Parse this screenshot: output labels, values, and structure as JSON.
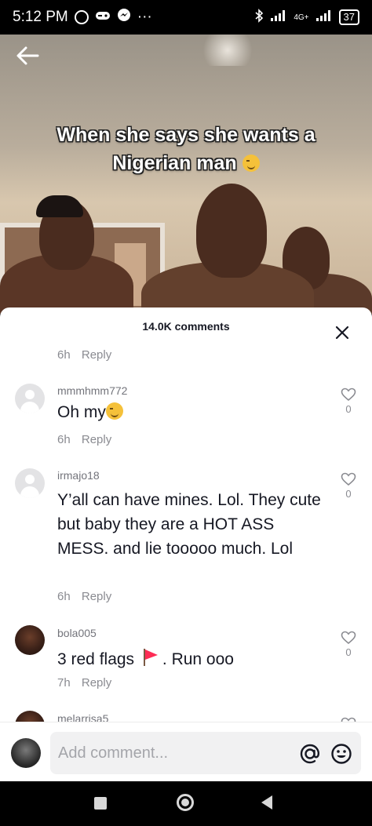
{
  "status_bar": {
    "time": "5:12 PM",
    "network": "4G+",
    "battery": "37"
  },
  "video": {
    "caption_line1": "When she says she wants a",
    "caption_line2": "Nigerian man",
    "caption_emoji": "sweat-smile-emoji"
  },
  "comments_panel": {
    "title": "14.0K comments",
    "top_meta": {
      "time": "6h",
      "reply": "Reply"
    },
    "comments": [
      {
        "username": "mmmhmm772",
        "text": "Oh my",
        "emoji": "smirk-emoji",
        "time": "6h",
        "reply": "Reply",
        "likes": "0"
      },
      {
        "username": "irmajo18",
        "text": "Y’all can have mines. Lol. They cute but baby they are a HOT ASS MESS. and lie tooooo much. Lol",
        "time": "6h",
        "reply": "Reply",
        "likes": "0"
      },
      {
        "username": "bola005",
        "text_before": "3 red flags",
        "text_after": ". Run ooo",
        "emoji": "red-flag-emoji",
        "time": "7h",
        "reply": "Reply",
        "likes": "0"
      },
      {
        "username": "melarrisa5"
      }
    ]
  },
  "input": {
    "placeholder": "Add comment..."
  },
  "colors": {
    "text_primary": "#161823",
    "text_secondary": "#8a8b91",
    "red_flag": "#fe2c55"
  }
}
